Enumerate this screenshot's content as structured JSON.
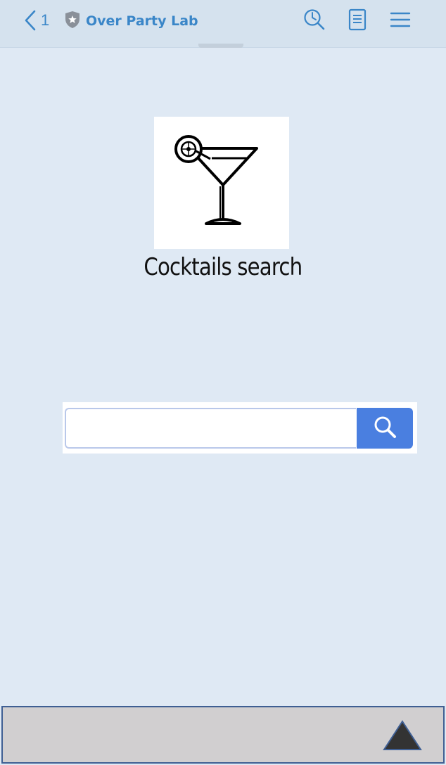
{
  "topbar": {
    "back_count": "1",
    "site_title": "Over Party Lab",
    "icons": {
      "back": "chevron-left-icon",
      "shield": "shield-star-icon",
      "history": "clock-search-icon",
      "reader": "document-icon",
      "menu": "hamburger-menu-icon"
    },
    "accent_color": "#3a86c8"
  },
  "main": {
    "logo_icon": "martini-glass-icon",
    "title": "Cocktails search"
  },
  "search": {
    "value": "",
    "placeholder": "",
    "button_icon": "search-icon",
    "button_color": "#4a7fe0"
  },
  "bottom_bar": {
    "scroll_top_icon": "triangle-up-icon"
  }
}
